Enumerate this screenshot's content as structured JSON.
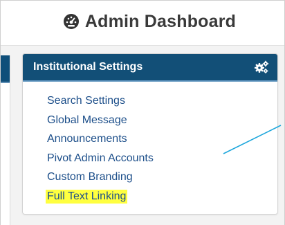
{
  "header": {
    "title": "Admin Dashboard",
    "icon": "dashboard-icon"
  },
  "panel": {
    "title": "Institutional Settings",
    "settings_icon": "gears-icon",
    "links": [
      {
        "label": "Search Settings",
        "highlighted": false
      },
      {
        "label": "Global Message",
        "highlighted": false
      },
      {
        "label": "Announcements",
        "highlighted": false
      },
      {
        "label": "Pivot Admin Accounts",
        "highlighted": false
      },
      {
        "label": "Custom Branding",
        "highlighted": false
      },
      {
        "label": "Full Text Linking",
        "highlighted": true
      }
    ]
  },
  "colors": {
    "panel_header": "#124f77",
    "link": "#1d4f8a",
    "highlight": "#ffff40",
    "annotation_line": "#1ea7dc"
  }
}
